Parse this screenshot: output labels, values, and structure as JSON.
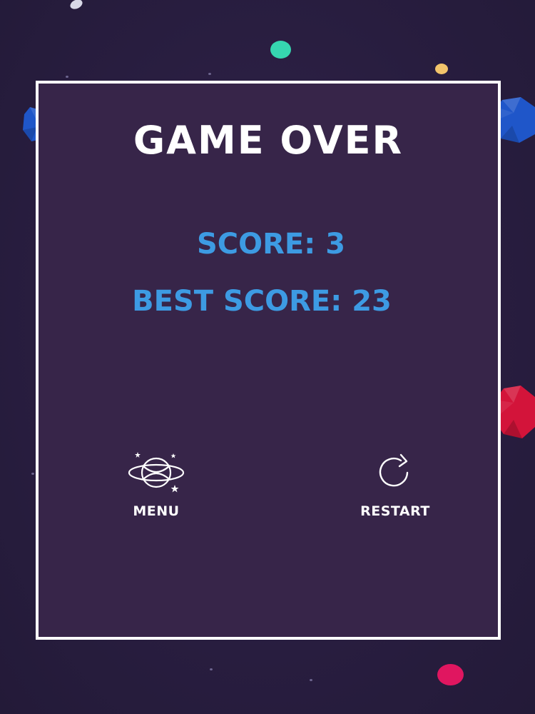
{
  "game_over": {
    "title": "GAME OVER",
    "score_label": "SCORE:",
    "score_value": "3",
    "best_score_label": "BEST SCORE:",
    "best_score_value": "23"
  },
  "buttons": {
    "menu": {
      "label": "MENU",
      "icon": "planet-orbit-icon"
    },
    "restart": {
      "label": "RESTART",
      "icon": "restart-arrow-icon"
    }
  },
  "colors": {
    "background": "#2a1f41",
    "panel": "#372549",
    "panel_border": "#ffffff",
    "title": "#ffffff",
    "score_text": "#3d9be3",
    "button_text": "#ffffff",
    "dot_teal": "#36d6b0",
    "dot_yellow": "#f2c46b",
    "dot_pink": "#e01660",
    "gem_blue": "#1f56c9",
    "gem_red": "#d3143a"
  }
}
